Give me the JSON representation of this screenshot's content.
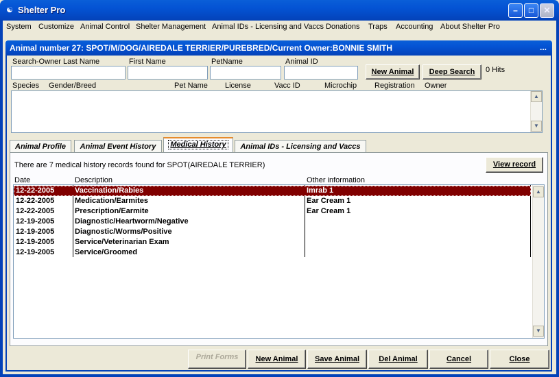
{
  "window": {
    "title": "Shelter Pro"
  },
  "menu": [
    "System",
    "Customize",
    "Animal Control",
    "Shelter Management",
    "Animal IDs - Licensing and Vaccs",
    "Donations",
    "Traps",
    "Accounting",
    "About Shelter Pro"
  ],
  "child": {
    "title": "Animal number 27: SPOT/M/DOG/AIREDALE TERRIER/PUREBRED/Current Owner:BONNIE SMITH",
    "dots": "..."
  },
  "search": {
    "owner_last_label": "Search-Owner Last Name",
    "first_name_label": "First Name",
    "pet_name_label": "PetName",
    "animal_id_label": "Animal ID",
    "owner_last_value": "",
    "first_name_value": "",
    "pet_name_value": "",
    "animal_id_value": "",
    "new_animal_label": "New Animal",
    "deep_search_label": "Deep Search",
    "hits": "0 Hits"
  },
  "results_columns": [
    "Species",
    "Gender/Breed",
    "Pet Name",
    "License",
    "Vacc ID",
    "Microchip",
    "Registration",
    "Owner"
  ],
  "tabs": [
    "Animal Profile",
    "Animal Event History",
    "Medical History",
    "Animal IDs - Licensing and Vaccs"
  ],
  "active_tab": "Medical History",
  "medical": {
    "summary": "There are 7 medical history records found for SPOT(AIREDALE TERRIER)",
    "view_record_label": "View record",
    "columns": [
      "Date",
      "Description",
      "Other information"
    ],
    "rows": [
      {
        "date": "12-22-2005",
        "description": "Vaccination/Rabies",
        "other": "Imrab 1"
      },
      {
        "date": "12-22-2005",
        "description": "Medication/Earmites",
        "other": "Ear Cream 1"
      },
      {
        "date": "12-22-2005",
        "description": "Prescription/Earmite",
        "other": "Ear Cream 1"
      },
      {
        "date": "12-19-2005",
        "description": "Diagnostic/Heartworm/Negative",
        "other": ""
      },
      {
        "date": "12-19-2005",
        "description": "Diagnostic/Worms/Positive",
        "other": ""
      },
      {
        "date": "12-19-2005",
        "description": "Service/Veterinarian Exam",
        "other": ""
      },
      {
        "date": "12-19-2005",
        "description": "Service/Groomed",
        "other": ""
      }
    ]
  },
  "bottom_buttons": {
    "print_forms": "Print Forms",
    "new_animal": "New Animal",
    "save_animal": "Save Animal",
    "del_animal": "Del Animal",
    "cancel": "Cancel",
    "close": "Close"
  },
  "colors": {
    "title_blue": "#0453d4",
    "selected_row": "#800000",
    "face": "#ece9d8"
  }
}
